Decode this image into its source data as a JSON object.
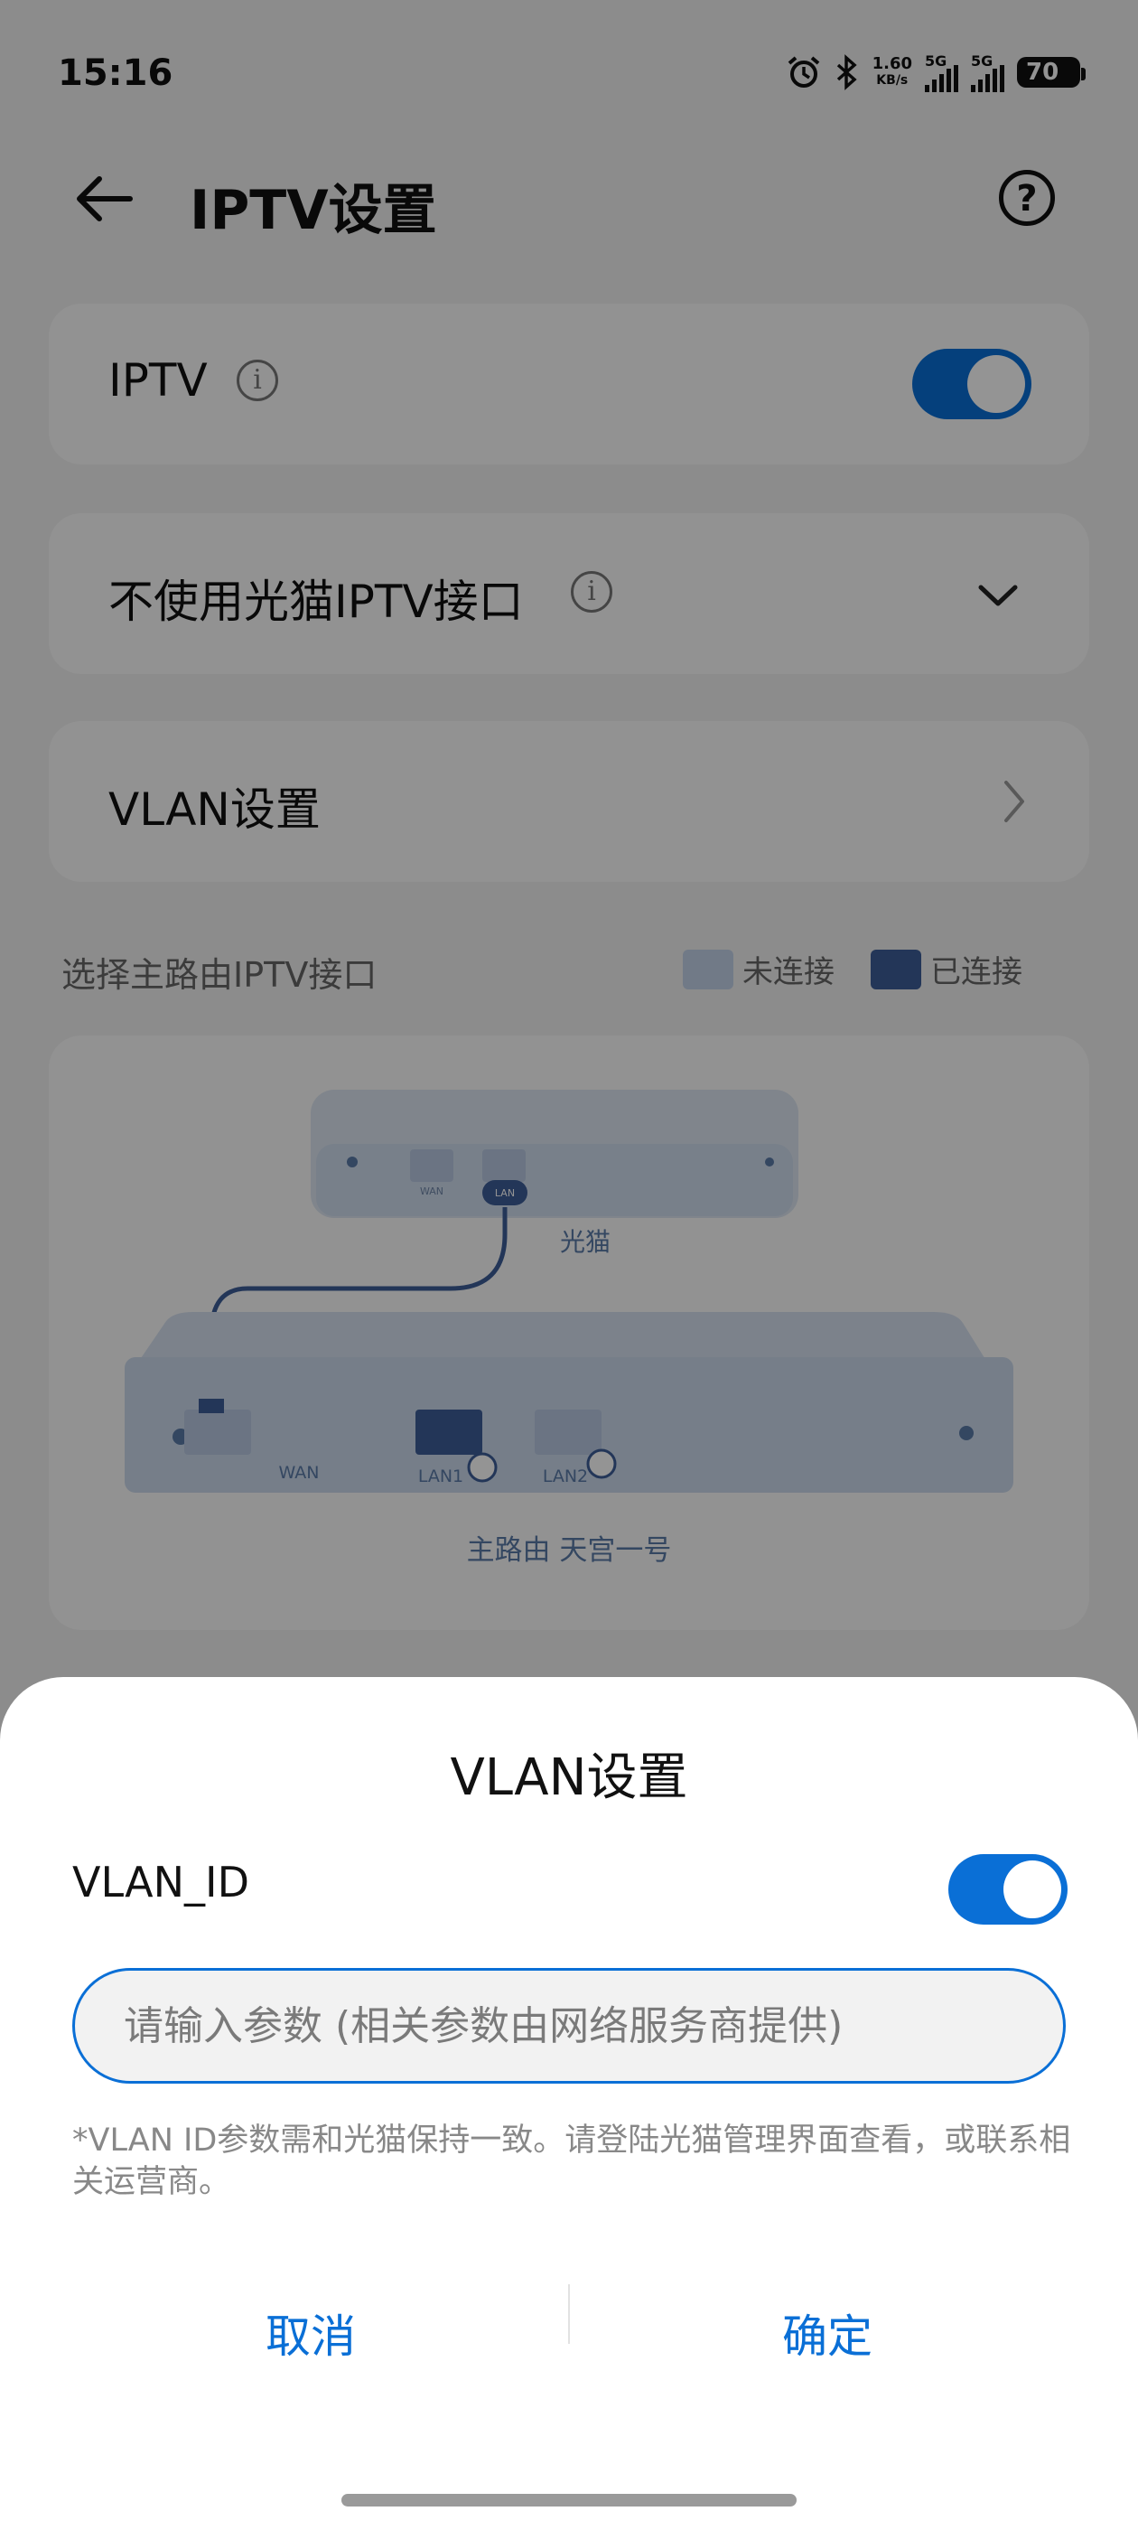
{
  "status_bar": {
    "time": "15:16",
    "net_speed_value": "1.60",
    "net_speed_unit": "KB/s",
    "signal1_label": "5G",
    "signal2_label": "5G",
    "battery": "70"
  },
  "header": {
    "title": "IPTV设置"
  },
  "iptv_row": {
    "label": "IPTV",
    "info_icon": "i",
    "enabled": true
  },
  "mode_row": {
    "label": "不使用光猫IPTV接口",
    "info_icon": "i"
  },
  "vlan_row": {
    "label": "VLAN设置"
  },
  "section": {
    "label": "选择主路由IPTV接口",
    "legend_disconnected": "未连接",
    "legend_connected": "已连接"
  },
  "diagram": {
    "modem_ports": [
      "WAN",
      "LAN"
    ],
    "modem_label": "光猫",
    "router_ports": [
      "WAN",
      "LAN1",
      "LAN2"
    ],
    "router_label": "主路由 天宫一号"
  },
  "sheet": {
    "title": "VLAN设置",
    "vlan_id_label": "VLAN_ID",
    "vlan_id_enabled": true,
    "input_placeholder": "请输入参数 (相关参数由网络服务商提供)",
    "input_value": "",
    "hint": "*VLAN ID参数需和光猫保持一致。请登陆光猫管理界面查看，或联系相关运营商。",
    "cancel_label": "取消",
    "confirm_label": "确定"
  },
  "colors": {
    "accent": "#0a6fd6",
    "port_disconnected": "#c3d3e8",
    "port_connected": "#3d5e98"
  }
}
